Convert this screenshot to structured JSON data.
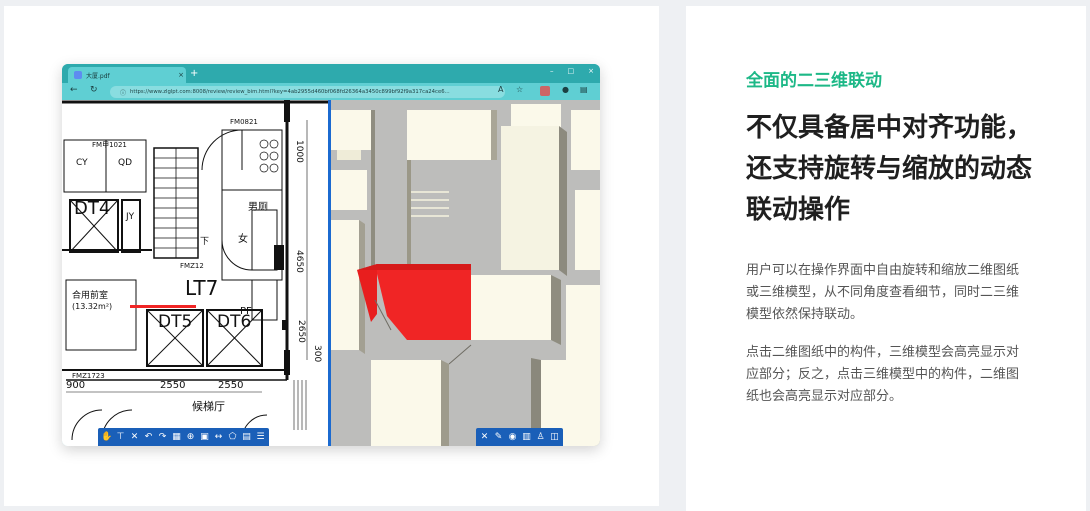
{
  "browser": {
    "tab_title": "大厦.pdf",
    "tab_close": "×",
    "new_tab": "+",
    "win_controls": [
      "–",
      "□",
      "×"
    ],
    "url": "https://www.zlglpt.com:8008/review/review_bim.html?key=4ab2955d460bf068fd26364a3450c899bf92f9a317ca24ce6..."
  },
  "cad_labels": {
    "dt4": "DT4",
    "dt5": "DT5",
    "dt6": "DT6",
    "lt7": "LT7",
    "cy": "CY",
    "qd": "QD",
    "pf": "PF",
    "jy": "JY",
    "fm1021": "FM甲1021",
    "fm0821": "FM0821",
    "fmz1723": "FMZ1723",
    "fmz1221": "FMZ12",
    "heyong": "合用前室",
    "area": "(13.32m²)",
    "nan": "男厕",
    "nv": "女",
    "xia": "下",
    "lobby": "候梯厅",
    "dim_2550a": "2550",
    "dim_2550b": "2550",
    "dim_900": "900",
    "dim_1000": "1000",
    "dim_300": "300",
    "dim_2650": "2650",
    "dim_4650": "4650"
  },
  "tools_2d": [
    "hand-icon",
    "pin-icon",
    "fit-icon",
    "undo-icon",
    "redo-icon",
    "grid-icon",
    "zoom-icon",
    "frame-icon",
    "measure-icon",
    "shape-icon",
    "layers-icon",
    "list-icon"
  ],
  "tools_3d": [
    "fit-icon",
    "pencil-icon",
    "eye-icon",
    "section-icon",
    "tree-icon",
    "split-icon"
  ],
  "right": {
    "kicker": "全面的二三维联动",
    "headline": "不仅具备居中对齐功能，还支持旋转与缩放的动态联动操作",
    "p1": "用户可以在操作界面中自由旋转和缩放二维图纸或三维模型，从不同角度查看细节，同时二三维模型依然保持联动。",
    "p2": "点击二维图纸中的构件，三维模型会高亮显示对应部分；反之，点击三维模型中的构件，二维图纸也会高亮显示对应部分。"
  },
  "colors": {
    "accent_green": "#1db887",
    "highlight_red": "#f02525",
    "toolbar_blue": "#1a5fb8",
    "browser_teal": "#4fc3c9"
  }
}
